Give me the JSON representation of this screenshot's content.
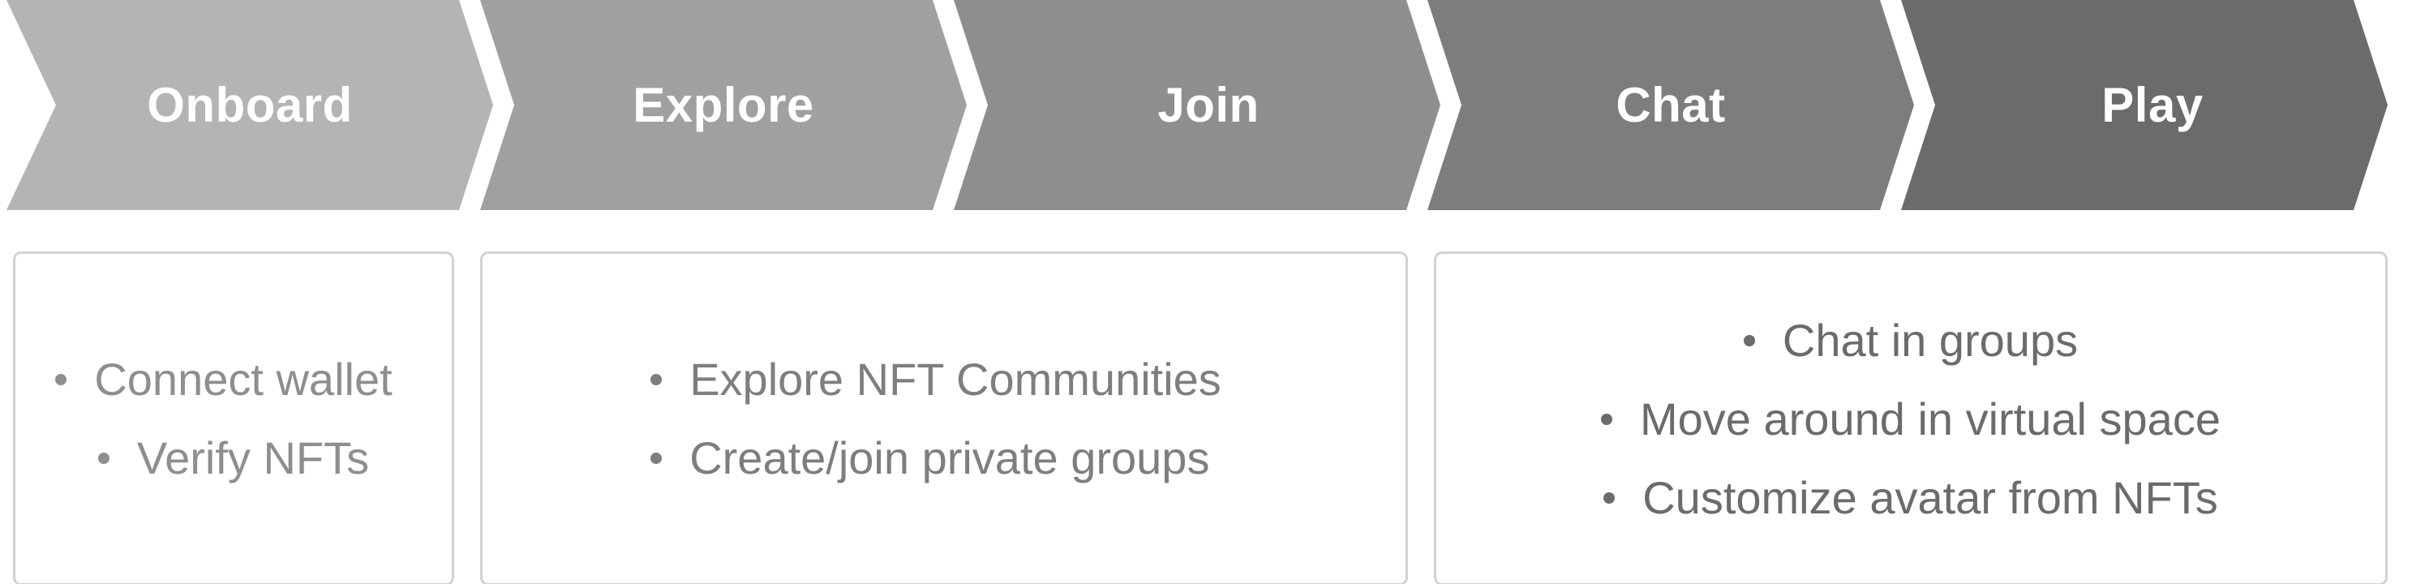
{
  "steps": [
    {
      "label": "Onboard",
      "color": "#b4b4b4"
    },
    {
      "label": "Explore",
      "color": "#a0a0a0"
    },
    {
      "label": "Join",
      "color": "#8e8e8e"
    },
    {
      "label": "Chat",
      "color": "#7d7d7d"
    },
    {
      "label": "Play",
      "color": "#6b6b6b"
    }
  ],
  "boxes": [
    {
      "text_color": "#8e8e8e",
      "items": [
        "Connect wallet",
        "Verify NFTs"
      ]
    },
    {
      "text_color": "#7e7e7e",
      "items": [
        "Explore NFT Communities",
        "Create/join private groups"
      ]
    },
    {
      "text_color": "#6b6b6b",
      "items": [
        "Chat in groups",
        "Move around in virtual space",
        "Customize avatar from NFTs"
      ]
    }
  ]
}
